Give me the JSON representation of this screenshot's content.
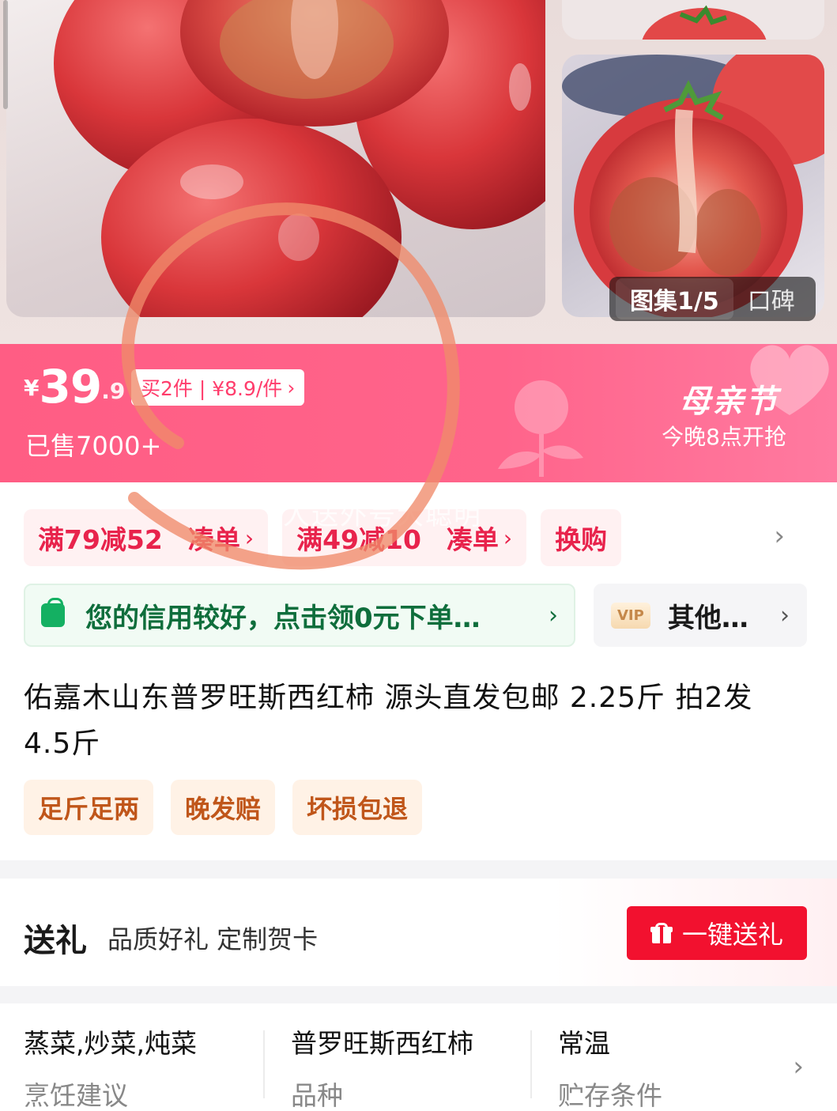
{
  "gallery": {
    "counter_label": "图集1/5",
    "reviews_tab": "口碑"
  },
  "price": {
    "currency": "¥",
    "integer": "39",
    "decimal": ".9",
    "bundle_offer": "买2件 | ¥8.9/件",
    "sold": "已售7000+",
    "festival_title": "母亲节",
    "festival_subtitle": "今晚8点开抢"
  },
  "promos": [
    {
      "label": "满79减52",
      "action": "凑单"
    },
    {
      "label": "满49减10",
      "action": "凑单"
    },
    {
      "label": "换购",
      "action": ""
    }
  ],
  "credit": {
    "text": "您的信用较好，点击领0元下单…"
  },
  "vip": {
    "badge": "VIP",
    "text": "其他…"
  },
  "product": {
    "title": "佑嘉木山东普罗旺斯西红柿 源头直发包邮 2.25斤 拍2发4.5斤",
    "tags": [
      "足斤足两",
      "晚发赔",
      "坏损包退"
    ]
  },
  "gift": {
    "title": "送礼",
    "subtitle": "品质好礼 定制贺卡",
    "button": "一键送礼"
  },
  "specs": [
    {
      "value": "蒸菜,炒菜,炖菜",
      "label": "烹饪建议"
    },
    {
      "value": "普罗旺斯西红柿",
      "label": "品种"
    },
    {
      "value": "常温",
      "label": "贮存条件"
    }
  ],
  "watermark": "人送外号大聪明",
  "colors": {
    "banner_pink": "#ff5d84",
    "promo_red": "#e8234c",
    "credit_green": "#0f6e3c",
    "gift_red": "#f2112f",
    "tag_orange": "#c0561a",
    "ring_orange": "#f08a6a"
  }
}
